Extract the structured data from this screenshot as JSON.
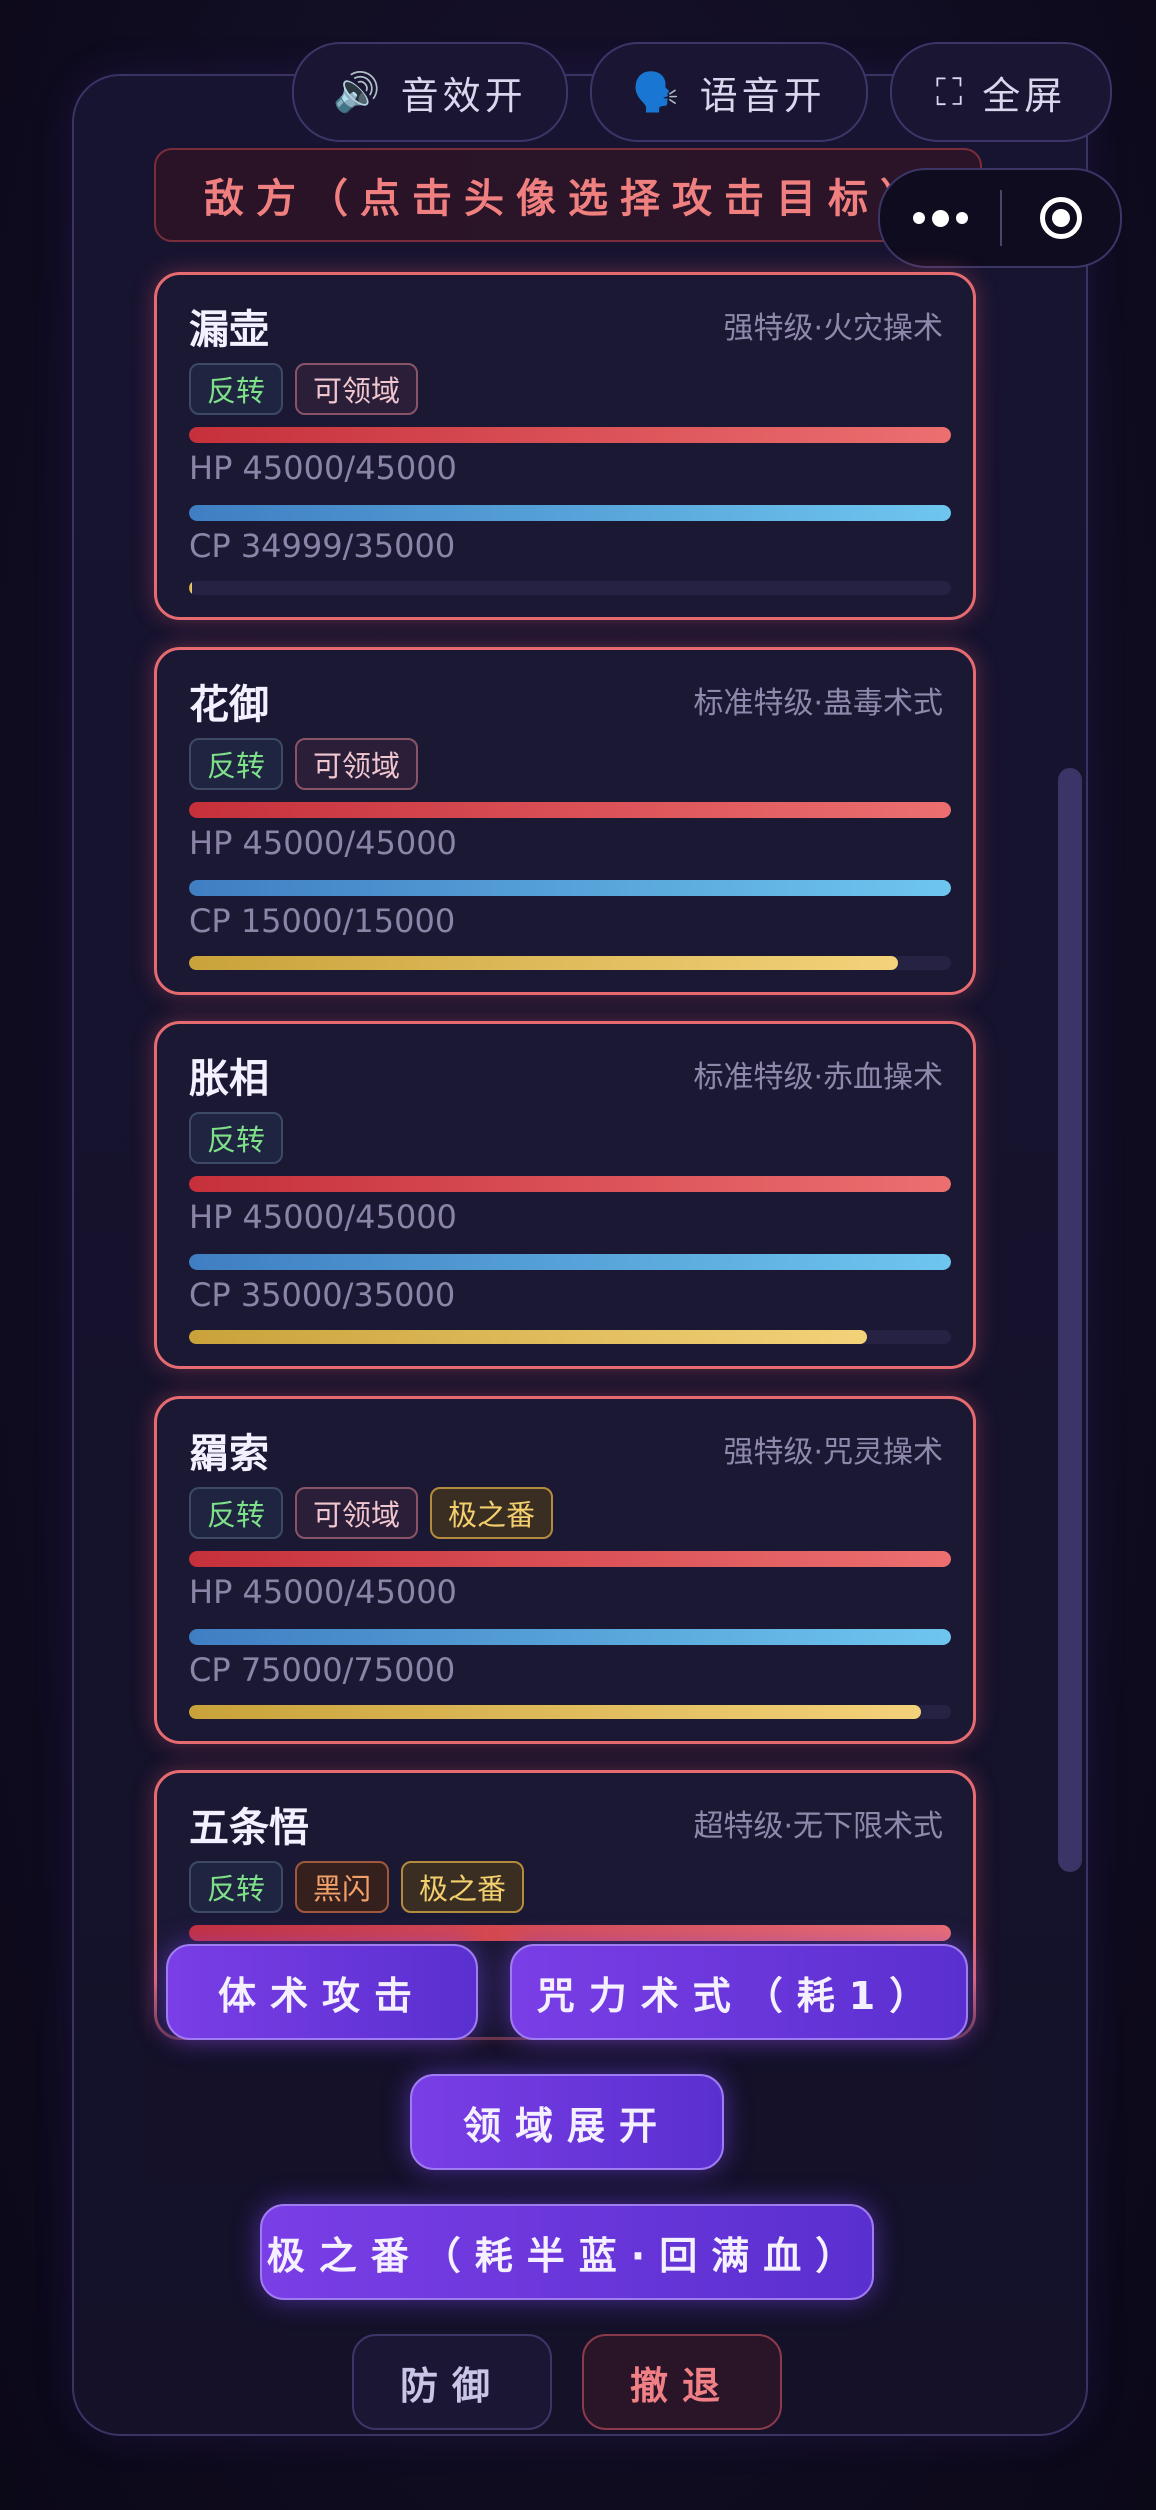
{
  "topbar": {
    "sound": {
      "icon": "speaker-icon",
      "glyph": "🔊",
      "label": "音效开"
    },
    "voice": {
      "icon": "speaking-head-icon",
      "glyph": "🗣️",
      "label": "语音开"
    },
    "fullscreen": {
      "icon": "fullscreen-icon",
      "glyph": "⛶",
      "label": "全屏"
    }
  },
  "enemy_header": "敌方（点击头像选择攻击目标）",
  "enemies": [
    {
      "name": "漏壶",
      "grade": "强特级·火灾操术",
      "tags": [
        {
          "text": "反转",
          "color": "green"
        },
        {
          "text": "可领域",
          "color": "pink"
        }
      ],
      "hp": "HP 45000/45000",
      "hp_frac": 1.0,
      "cp": "CP 34999/35000",
      "cp_frac": 1.0,
      "ce_frac": 0.004
    },
    {
      "name": "花御",
      "grade": "标准特级·蛊毒术式",
      "tags": [
        {
          "text": "反转",
          "color": "green"
        },
        {
          "text": "可领域",
          "color": "pink"
        }
      ],
      "hp": "HP 45000/45000",
      "hp_frac": 1.0,
      "cp": "CP 15000/15000",
      "cp_frac": 1.0,
      "ce_frac": 0.93
    },
    {
      "name": "胀相",
      "grade": "标准特级·赤血操术",
      "tags": [
        {
          "text": "反转",
          "color": "green"
        }
      ],
      "hp": "HP 45000/45000",
      "hp_frac": 1.0,
      "cp": "CP 35000/35000",
      "cp_frac": 1.0,
      "ce_frac": 0.89
    },
    {
      "name": "羂索",
      "grade": "强特级·咒灵操术",
      "tags": [
        {
          "text": "反转",
          "color": "green"
        },
        {
          "text": "可领域",
          "color": "pink"
        },
        {
          "text": "极之番",
          "color": "gold"
        }
      ],
      "hp": "HP 45000/45000",
      "hp_frac": 1.0,
      "cp": "CP 75000/75000",
      "cp_frac": 1.0,
      "ce_frac": 0.96
    },
    {
      "name": "五条悟",
      "grade": "超特级·无下限术式",
      "tags": [
        {
          "text": "反转",
          "color": "green"
        },
        {
          "text": "黑闪",
          "color": "orange"
        },
        {
          "text": "极之番",
          "color": "gold"
        }
      ],
      "hp_frac": 1.0
    }
  ],
  "actions": {
    "physical": "体术攻击",
    "cursed": "咒力术式（耗1）",
    "domain": "领域展开",
    "ultimate": "极之番（耗半蓝·回满血）",
    "defend": "防御",
    "retreat": "撤退"
  },
  "colors": {
    "accent": "#7a3ee6",
    "enemy": "#e56b70",
    "hp": "#ec6f70",
    "cp": "#6ec6ef",
    "ce": "#f3d27a"
  }
}
